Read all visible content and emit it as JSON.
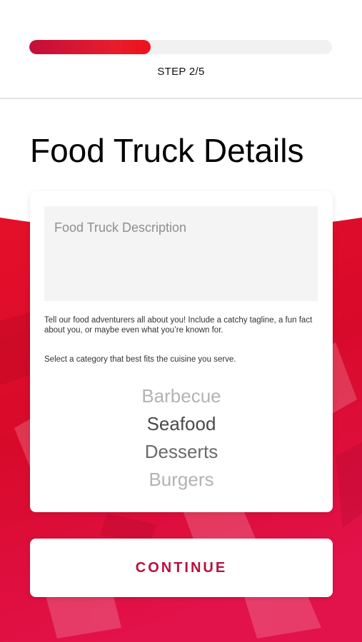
{
  "progress": {
    "step_label": "STEP 2/5",
    "fraction": 0.4
  },
  "page": {
    "title": "Food Truck Details"
  },
  "form": {
    "description_placeholder": "Food Truck Description",
    "description_value": "",
    "helper_text": "Tell our food adventurers all about you! Include a catchy tagline, a fun fact about you, or maybe even what you’re known for.",
    "category_prompt": "Select a category that best fits the cuisine you serve.",
    "category_options": [
      "Barbecue",
      "Seafood",
      "Desserts",
      "Burgers"
    ],
    "selected_category": "Seafood"
  },
  "actions": {
    "continue_label": "CONTINUE"
  },
  "colors": {
    "accent": "#e8142a",
    "accent_dark": "#c20f3a",
    "continue_text": "#b7103f",
    "picker_selected": "#4a4a4a",
    "picker_near": "#6a6a6a",
    "picker_far": "#b3b3b3"
  }
}
